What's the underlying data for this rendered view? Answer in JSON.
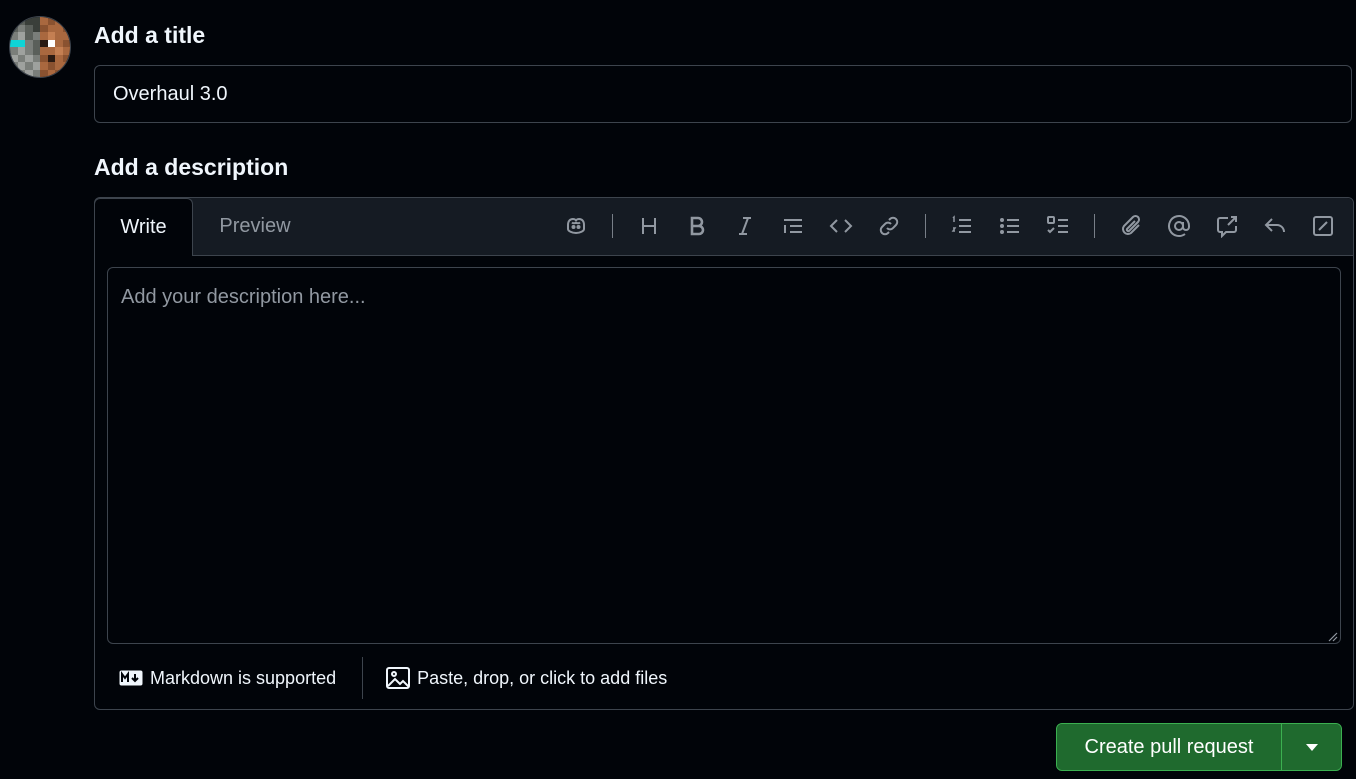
{
  "user": {
    "avatar_label": "user avatar"
  },
  "title_section": {
    "heading": "Add a title",
    "value": "Overhaul 3.0"
  },
  "description_section": {
    "heading": "Add a description",
    "tabs": [
      {
        "label": "Write",
        "selected": true
      },
      {
        "label": "Preview",
        "selected": false
      }
    ],
    "toolbar": [
      "copilot-icon",
      "heading-icon",
      "bold-icon",
      "italic-icon",
      "quote-icon",
      "code-icon",
      "link-icon",
      "ordered-list-icon",
      "unordered-list-icon",
      "task-list-icon",
      "attach-icon",
      "mention-icon",
      "cross-reference-icon",
      "saved-reply-icon",
      "slash-command-icon"
    ],
    "placeholder": "Add your description here...",
    "markdown_note": "Markdown is supported",
    "files_note": "Paste, drop, or click to add files"
  },
  "actions": {
    "create_label": "Create pull request"
  },
  "colors": {
    "background": "#010409",
    "border": "#3d444d",
    "muted": "#9198a1",
    "primary_button": "#1f6a2e",
    "primary_border": "#3bb050"
  }
}
